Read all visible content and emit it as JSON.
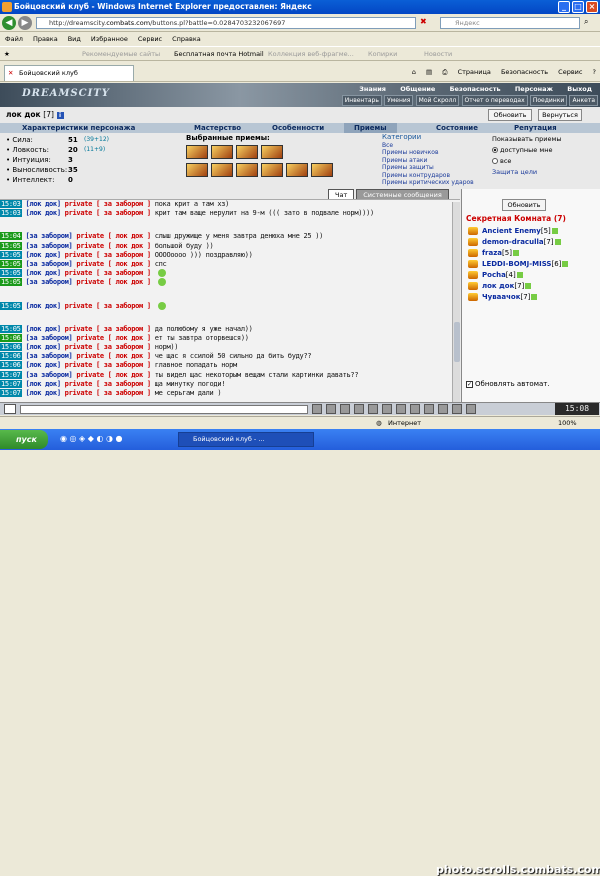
{
  "window": {
    "title": "Бойцовский клуб - Windows Internet Explorer предоставлен: Яндекс"
  },
  "address": {
    "url_prefix": "http://dreamscity.",
    "url_domain": "combats.com",
    "url_rest": "/buttons.pl?battle=0.0284703232067697",
    "search_placeholder": "Яндекс"
  },
  "menu": [
    "Файл",
    "Правка",
    "Вид",
    "Избранное",
    "Сервис",
    "Справка"
  ],
  "favorites": [
    "Рекомендуемые сайты",
    "Бесплатная почта Hotmail",
    "Коллекция веб-фрагме...",
    "Копирки",
    "Новости"
  ],
  "tab": {
    "label": "Бойцовский клуб"
  },
  "tab_tools": [
    "Страница",
    "Безопасность",
    "Сервис"
  ],
  "game": {
    "logo": "DREAMSCITY",
    "top_nav": [
      "Знания",
      "Общение",
      "Безопасность",
      "Персонаж",
      "Выход"
    ],
    "sub_nav": [
      "Инвентарь",
      "Умения",
      "Мой Скролл",
      "Отчет о переводах",
      "Поединки",
      "Анкета"
    ],
    "char_name": "лок док",
    "char_level": "[7]",
    "refresh_label": "Обновить",
    "back_label": "Вернуться",
    "section_tabs": [
      "Характеристики персонажа",
      "Мастерство",
      "Особенности",
      "Приемы",
      "Состояние",
      "Репутация"
    ],
    "stats": [
      {
        "label": "Сила:",
        "value": "51",
        "bonus": "(39+12)"
      },
      {
        "label": "Ловкость:",
        "value": "20",
        "bonus": "(11+9)"
      },
      {
        "label": "Интуиция:",
        "value": "3",
        "bonus": ""
      },
      {
        "label": "Выносливость:",
        "value": "35",
        "bonus": ""
      },
      {
        "label": "Интеллект:",
        "value": "0",
        "bonus": ""
      }
    ],
    "fav_skills_label": "Выбранные приемы:",
    "categories": [
      "Категории",
      "Все",
      "Приемы новичков",
      "Приемы атаки",
      "Приемы защиты",
      "Приемы контрударов",
      "Приемы критических ударов"
    ],
    "show_skills": {
      "label": "Показывать приемы",
      "opt1": "доступные мне",
      "opt2": "все"
    },
    "protect_label": "Защита цели",
    "chat_tabs": [
      "Чат",
      "Системные сообщения"
    ]
  },
  "chat": [
    {
      "time": "15:03",
      "nick": "[лок док]",
      "priv": "private [ за забором ]",
      "msg": "пока крит а там хз)",
      "green": false
    },
    {
      "time": "15:03",
      "nick": "[лок док]",
      "priv": "private [ за забором ]",
      "msg": "крит там ваще нерулит на 9-м ((( зато в подвале норм))))",
      "green": false
    },
    {
      "time": "",
      "nick": "",
      "priv": "",
      "msg": "",
      "green": false,
      "spacer": true
    },
    {
      "time": "15:04",
      "nick": "[за забором]",
      "priv": "private [ лок док ]",
      "msg": "слыш дружище у меня завтра денюха мне 25 ))",
      "green": true
    },
    {
      "time": "15:05",
      "nick": "[за забором]",
      "priv": "private [ лок док ]",
      "msg": "большой буду ))",
      "green": true
    },
    {
      "time": "15:05",
      "nick": "[лок док]",
      "priv": "private [ за забором ]",
      "msg": "ООООоооо ))) поздравляю))",
      "green": false
    },
    {
      "time": "15:05",
      "nick": "[за забором]",
      "priv": "private [ лок док ]",
      "msg": "спс",
      "green": true
    },
    {
      "time": "15:05",
      "nick": "[лок док]",
      "priv": "private [ за забором ]",
      "msg": "",
      "green": false
    },
    {
      "time": "15:05",
      "nick": "[за забором]",
      "priv": "private [ лок док ]",
      "msg": "",
      "green": true
    },
    {
      "time": "",
      "nick": "",
      "priv": "",
      "msg": "",
      "green": false,
      "spacer": true
    },
    {
      "time": "15:05",
      "nick": "[лок док]",
      "priv": "private [ за забором ]",
      "msg": "",
      "green": false
    },
    {
      "time": "",
      "nick": "",
      "priv": "",
      "msg": "",
      "green": false,
      "spacer": true
    },
    {
      "time": "15:05",
      "nick": "[лок док]",
      "priv": "private [ за забором ]",
      "msg": "да полюбому я уже начал))",
      "green": false
    },
    {
      "time": "15:06",
      "nick": "[за забором]",
      "priv": "private [ лок док ]",
      "msg": "ет ты завтра оторвешся))",
      "green": true
    },
    {
      "time": "15:06",
      "nick": "[лок док]",
      "priv": "private [ за забором ]",
      "msg": "норм))",
      "green": false
    },
    {
      "time": "15:06",
      "nick": "[за забором]",
      "priv": "private [ лок док ]",
      "msg": "че щас я ссилой 50 сильно да бить буду??",
      "green": false
    },
    {
      "time": "15:06",
      "nick": "[лок док]",
      "priv": "private [ за забором ]",
      "msg": "главное попадать норм",
      "green": false
    },
    {
      "time": "15:07",
      "nick": "[за забором]",
      "priv": "private [ лок док ]",
      "msg": "ты видел щас некоторым вещам стали картинки давать??",
      "green": false
    },
    {
      "time": "15:07",
      "nick": "[лок док]",
      "priv": "private [ за забором ]",
      "msg": "ща минутку погоди!",
      "green": false
    },
    {
      "time": "15:07",
      "nick": "[лок док]",
      "priv": "private [ за забором ]",
      "msg": "ме серьгам дали )",
      "green": false
    }
  ],
  "room": {
    "refresh_label": "Обновить",
    "title": "Секретная Комната (7)",
    "users": [
      {
        "name": "Ancient Enemy",
        "level": "[5]"
      },
      {
        "name": "demon-draculla",
        "level": "[7]"
      },
      {
        "name": "fraza",
        "level": "[5]"
      },
      {
        "name": "LEDDI-BOMJ-MISS",
        "level": "[6]"
      },
      {
        "name": "Pocha",
        "level": "[4]"
      },
      {
        "name": "лок док",
        "level": "[7]"
      },
      {
        "name": "Чуваачок",
        "level": "[7]"
      }
    ],
    "auto_refresh": "Обновлять автомат."
  },
  "clock": "15:08",
  "status": {
    "zone": "Интернет",
    "zoom": "100%"
  },
  "taskbar": {
    "start": "пуск",
    "item": "Бойцовский клуб - ..."
  },
  "watermark": "photo.scrolls.combats.com"
}
